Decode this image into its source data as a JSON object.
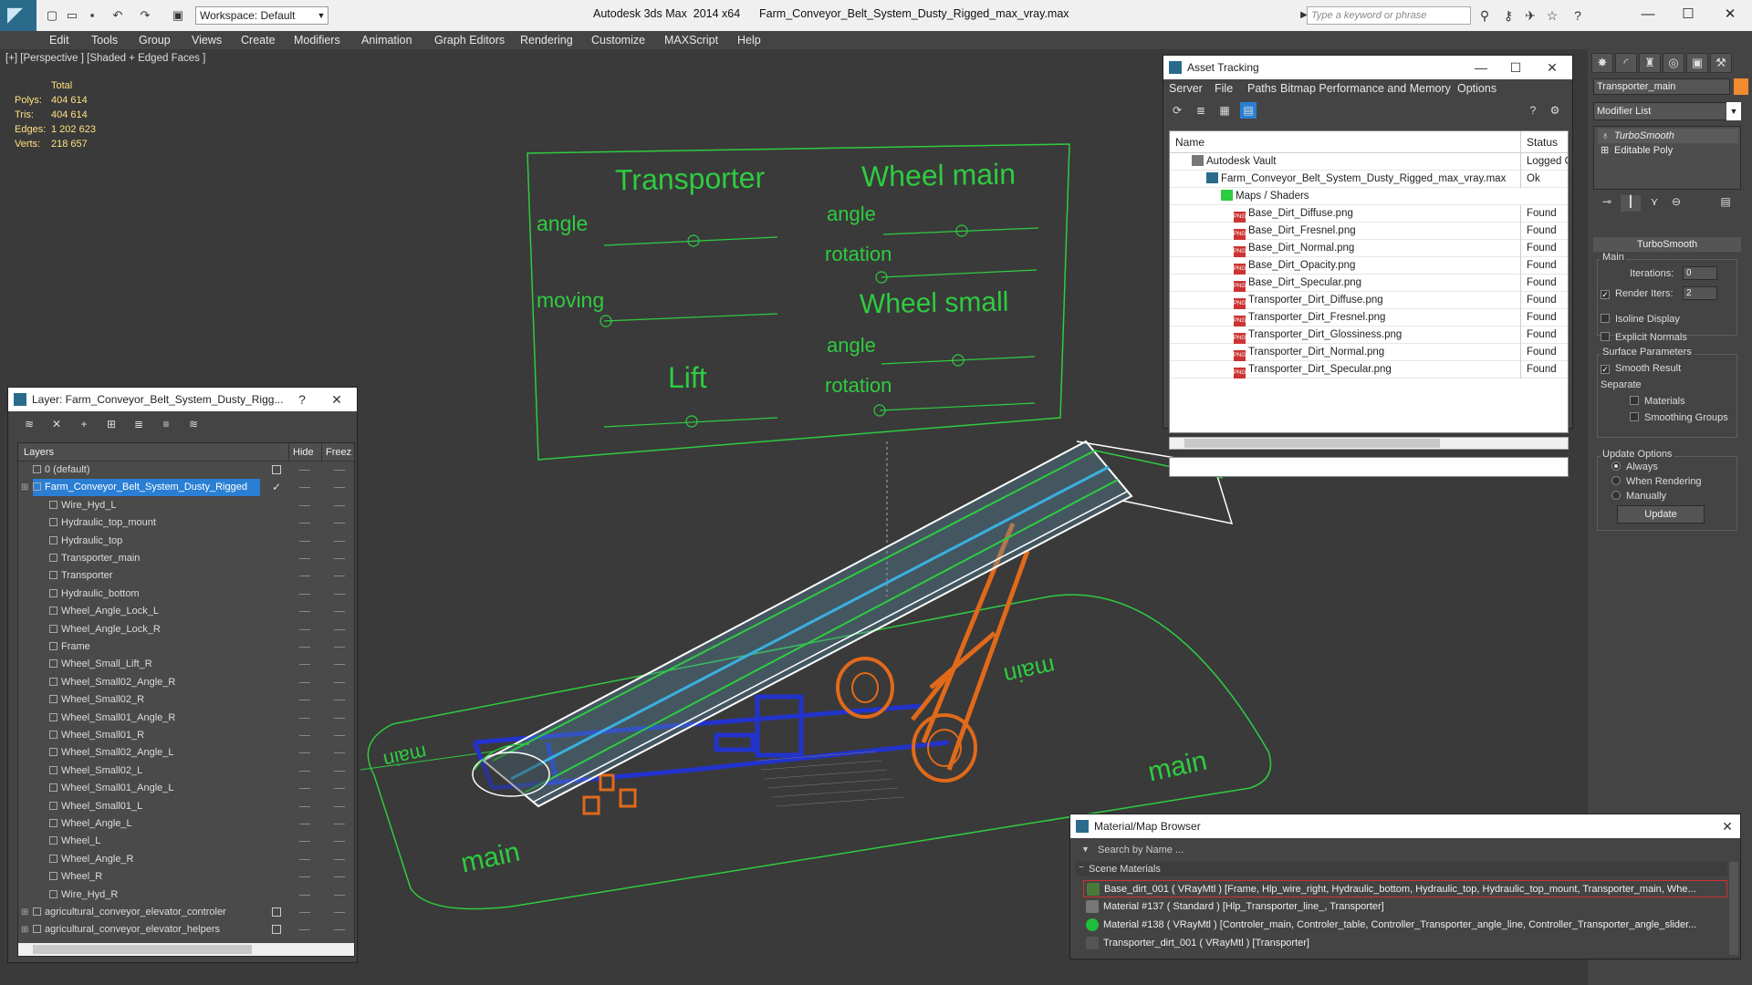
{
  "app": {
    "title": "Autodesk 3ds Max  2014 x64      Farm_Conveyor_Belt_System_Dusty_Rigged_max_vray.max",
    "workspace": "Workspace: Default",
    "search_placeholder": "Type a keyword or phrase"
  },
  "menu": [
    "Edit",
    "Tools",
    "Group",
    "Views",
    "Create",
    "Modifiers",
    "Animation",
    "Graph Editors",
    "Rendering",
    "Customize",
    "MAXScript",
    "Help"
  ],
  "viewport": {
    "label": "[+] [Perspective ] [Shaded + Edged Faces ]",
    "stats": {
      "header": "Total",
      "polys_label": "Polys:",
      "polys": "404 614",
      "tris_label": "Tris:",
      "tris": "404 614",
      "edges_label": "Edges:",
      "edges": "1 202 623",
      "verts_label": "Verts:",
      "verts": "218 657"
    },
    "controller": {
      "transporter": "Transporter",
      "wheel_main": "Wheel main",
      "angle1": "angle",
      "angle2": "angle",
      "rotation1": "rotation",
      "moving": "moving",
      "wheel_small": "Wheel small",
      "angle3": "angle",
      "lift": "Lift",
      "rotation2": "rotation"
    },
    "floor_labels": [
      "main",
      "main",
      "main",
      "main"
    ]
  },
  "command_panel": {
    "object_name": "Transporter_main",
    "object_color": "#f28a2f",
    "modifier_list": "Modifier List",
    "stack": [
      "TurboSmooth",
      "Editable Poly"
    ],
    "rollout_title": "TurboSmooth",
    "main_label": "Main",
    "iterations_label": "Iterations:",
    "iterations": "0",
    "render_iters_label": "Render Iters:",
    "render_iters": "2",
    "render_iters_checked": "✓",
    "isoline": "Isoline Display",
    "explicit_normals": "Explicit Normals",
    "surface_params": "Surface Parameters",
    "smooth_result": "Smooth Result",
    "smooth_checked": "✓",
    "separate": "Separate",
    "materials": "Materials",
    "smoothing_groups": "Smoothing Groups",
    "update_options": "Update Options",
    "always": "Always",
    "when_rendering": "When Rendering",
    "manually": "Manually",
    "update_btn": "Update"
  },
  "asset_tracking": {
    "title": "Asset Tracking",
    "menu": [
      "Server",
      "File",
      "Paths",
      "Bitmap Performance and Memory",
      "Options"
    ],
    "col_name": "Name",
    "col_status": "Status",
    "rows": [
      {
        "name": "Autodesk Vault",
        "status": "Logged O",
        "indent": 0
      },
      {
        "name": "Farm_Conveyor_Belt_System_Dusty_Rigged_max_vray.max",
        "status": "Ok",
        "indent": 1
      },
      {
        "name": "Maps / Shaders",
        "status": "",
        "indent": 2
      },
      {
        "name": "Base_Dirt_Diffuse.png",
        "status": "Found",
        "indent": 3
      },
      {
        "name": "Base_Dirt_Fresnel.png",
        "status": "Found",
        "indent": 3
      },
      {
        "name": "Base_Dirt_Normal.png",
        "status": "Found",
        "indent": 3
      },
      {
        "name": "Base_Dirt_Opacity.png",
        "status": "Found",
        "indent": 3
      },
      {
        "name": "Base_Dirt_Specular.png",
        "status": "Found",
        "indent": 3
      },
      {
        "name": "Transporter_Dirt_Diffuse.png",
        "status": "Found",
        "indent": 3
      },
      {
        "name": "Transporter_Dirt_Fresnel.png",
        "status": "Found",
        "indent": 3
      },
      {
        "name": "Transporter_Dirt_Glossiness.png",
        "status": "Found",
        "indent": 3
      },
      {
        "name": "Transporter_Dirt_Normal.png",
        "status": "Found",
        "indent": 3
      },
      {
        "name": "Transporter_Dirt_Specular.png",
        "status": "Found",
        "indent": 3
      }
    ]
  },
  "layer_window": {
    "title": "Layer: Farm_Conveyor_Belt_System_Dusty_Rigg...",
    "help": "?",
    "col_layers": "Layers",
    "col_hide": "Hide",
    "col_freeze": "Freez",
    "rows": [
      {
        "name": "0 (default)",
        "type": "layer",
        "box": true
      },
      {
        "name": "Farm_Conveyor_Belt_System_Dusty_Rigged",
        "type": "layer-selected",
        "check": "✓"
      },
      {
        "name": "Wire_Hyd_L",
        "type": "obj"
      },
      {
        "name": "Hydraulic_top_mount",
        "type": "obj"
      },
      {
        "name": "Hydraulic_top",
        "type": "obj"
      },
      {
        "name": "Transporter_main",
        "type": "obj"
      },
      {
        "name": "Transporter",
        "type": "obj"
      },
      {
        "name": "Hydraulic_bottom",
        "type": "obj"
      },
      {
        "name": "Wheel_Angle_Lock_L",
        "type": "obj"
      },
      {
        "name": "Wheel_Angle_Lock_R",
        "type": "obj"
      },
      {
        "name": "Frame",
        "type": "obj"
      },
      {
        "name": "Wheel_Small_Lift_R",
        "type": "obj"
      },
      {
        "name": "Wheel_Small02_Angle_R",
        "type": "obj"
      },
      {
        "name": "Wheel_Small02_R",
        "type": "obj"
      },
      {
        "name": "Wheel_Small01_Angle_R",
        "type": "obj"
      },
      {
        "name": "Wheel_Small01_R",
        "type": "obj"
      },
      {
        "name": "Wheel_Small02_Angle_L",
        "type": "obj"
      },
      {
        "name": "Wheel_Small02_L",
        "type": "obj"
      },
      {
        "name": "Wheel_Small01_Angle_L",
        "type": "obj"
      },
      {
        "name": "Wheel_Small01_L",
        "type": "obj"
      },
      {
        "name": "Wheel_Angle_L",
        "type": "obj"
      },
      {
        "name": "Wheel_L",
        "type": "obj"
      },
      {
        "name": "Wheel_Angle_R",
        "type": "obj"
      },
      {
        "name": "Wheel_R",
        "type": "obj"
      },
      {
        "name": "Wire_Hyd_R",
        "type": "obj"
      },
      {
        "name": "agricultural_conveyor_elevator_controler",
        "type": "layer",
        "box": true
      },
      {
        "name": "agricultural_conveyor_elevator_helpers",
        "type": "layer",
        "box": true
      }
    ]
  },
  "material_browser": {
    "title": "Material/Map Browser",
    "search_placeholder": "Search by Name ...",
    "section": "Scene Materials",
    "materials": [
      {
        "text": "Base_dirt_001  ( VRayMtl )  [Frame, Hlp_wire_right, Hydraulic_bottom, Hydraulic_top, Hydraulic_top_mount, Transporter_main, Whe...",
        "color": "#4a7a3a"
      },
      {
        "text": "Material #137  ( Standard )  [Hlp_Transporter_line_, Transporter]",
        "color": "#777777"
      },
      {
        "text": "Material #138  ( VRayMtl )  [Controler_main, Controler_table, Controller_Transporter_angle_line, Controller_Transporter_angle_slider...",
        "color": "#1fbf3a"
      },
      {
        "text": "Transporter_dirt_001  ( VRayMtl )  [Transporter]",
        "color": "#555555"
      }
    ]
  },
  "colors": {
    "wire_green": "#2ecc40",
    "wire_blue": "#2233cc",
    "wire_orange": "#e06a1a",
    "selection": "#2a7fd4"
  }
}
